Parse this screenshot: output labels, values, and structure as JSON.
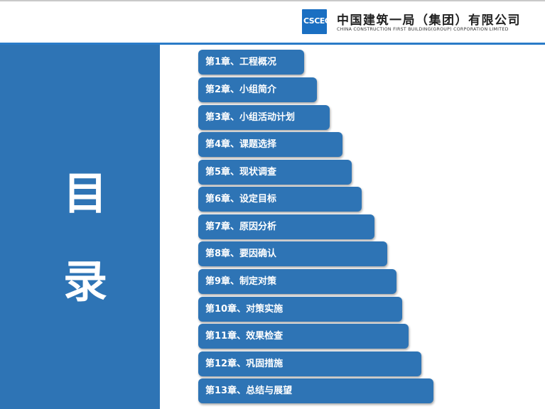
{
  "header": {
    "logo_text": "CSCEC",
    "company_name_cn": "中国建筑一局（集团）有限公司",
    "company_name_en": "CHINA CONSTRUCTION FIRST BUILDING(GROUP) CORPORATION LIMITED"
  },
  "sidebar": {
    "title_line1": "目",
    "title_line2": "录"
  },
  "toc": {
    "items": [
      "第1章、工程概况",
      "第2章、小组简介",
      "第3章、小组活动计划",
      "第4章、课题选择",
      "第5章、现状调查",
      "第6章、设定目标",
      "第7章、原因分析",
      "第8章、要因确认",
      "第9章、制定对策",
      "第10章、对策实施",
      "第11章、效果检查",
      "第12章、巩固措施",
      "第13章、总结与展望"
    ]
  },
  "colors": {
    "panel": "#2e74b5",
    "rule": "#2a7bc8",
    "logo": "#1a6fc2"
  }
}
